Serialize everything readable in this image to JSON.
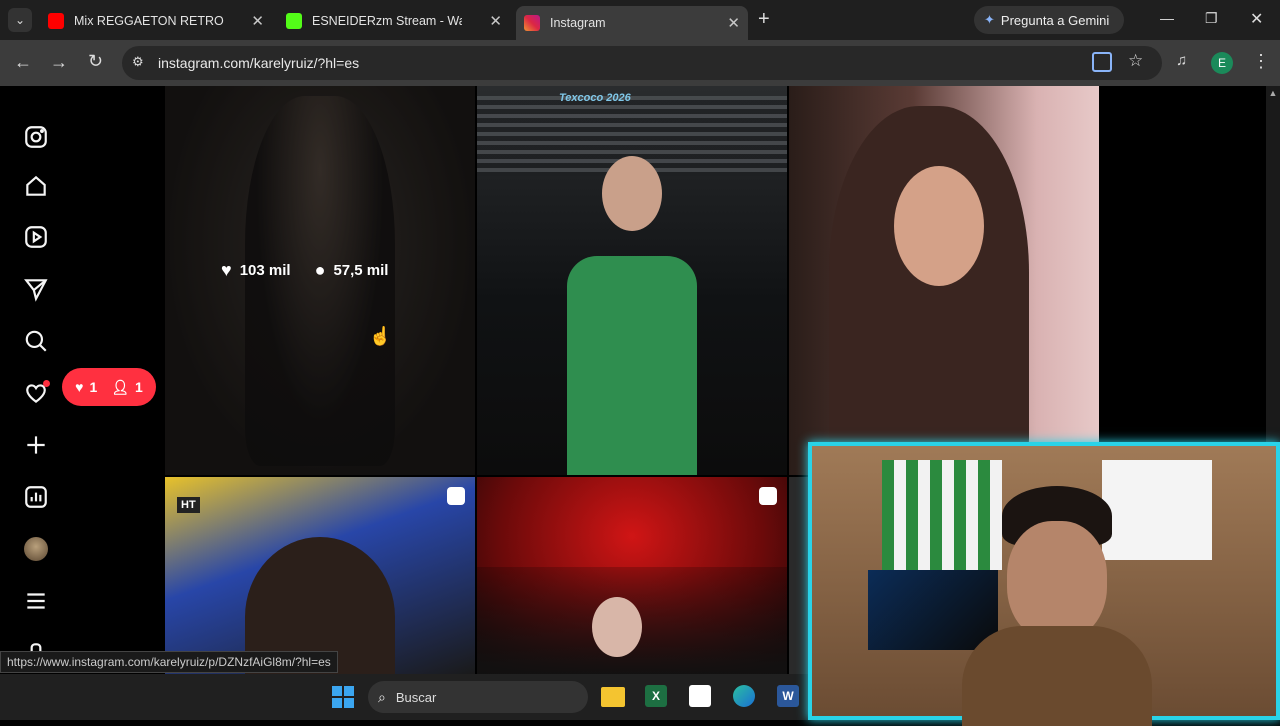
{
  "browser": {
    "tabs": [
      {
        "title": "Mix REGGAETON RETRO (Old S",
        "favicon_color": "#ff0000"
      },
      {
        "title": "ESNEIDERzm Stream - Watch Li",
        "favicon_color": "#53fc18"
      },
      {
        "title": "Instagram",
        "favicon_color": "#e1306c",
        "active": true
      }
    ],
    "gemini_label": "Pregunta a Gemini",
    "url": "instagram.com/karelyruiz/?hl=es",
    "profile_initial": "E",
    "status_url": "https://www.instagram.com/karelyruiz/p/DZNzfAiGl8m/?hl=es"
  },
  "sidebar": {
    "notifications": {
      "likes": "1",
      "follows": "1"
    }
  },
  "post": {
    "likes": "103 mil",
    "comments": "57,5 mil",
    "banner": "Texcoco 2026",
    "tag": "HT"
  },
  "taskbar": {
    "search_placeholder": "Buscar"
  }
}
